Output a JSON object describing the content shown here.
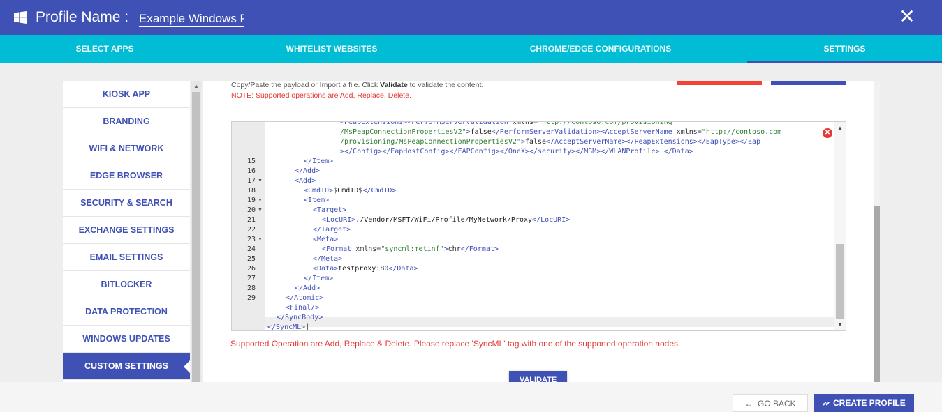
{
  "header": {
    "title_label": "Profile Name :",
    "profile_name_value": "Example Windows Pr",
    "close_label": "✕"
  },
  "tabs": [
    {
      "label": "SELECT APPS"
    },
    {
      "label": "WHITELIST WEBSITES"
    },
    {
      "label": "CHROME/EDGE CONFIGURATIONS"
    },
    {
      "label": "SETTINGS"
    }
  ],
  "sidebar": {
    "items": [
      {
        "label": "KIOSK APP"
      },
      {
        "label": "BRANDING"
      },
      {
        "label": "WIFI & NETWORK"
      },
      {
        "label": "EDGE BROWSER"
      },
      {
        "label": "SECURITY & SEARCH"
      },
      {
        "label": "EXCHANGE SETTINGS"
      },
      {
        "label": "EMAIL SETTINGS"
      },
      {
        "label": "BITLOCKER"
      },
      {
        "label": "DATA PROTECTION"
      },
      {
        "label": "WINDOWS UPDATES"
      },
      {
        "label": "CUSTOM SETTINGS"
      }
    ],
    "active_index": 10
  },
  "content": {
    "hint_before": "Copy/Paste the payload or Import a file. Click ",
    "hint_bold": "Validate",
    "hint_after": " to validate the content.",
    "note": "NOTE: Supported operations are Add, Replace, Delete.",
    "error_message": "Supported Operation are Add, Replace & Delete. Please replace 'SyncML' tag with one of the supported operation nodes.",
    "validate_label": "VALIDATE"
  },
  "editor": {
    "error_icon": "✕",
    "lines": [
      {
        "num": "",
        "fold": false,
        "indent": 8,
        "html": "<span class=\"tag\">&lt;PeapExtensions&gt;&lt;PerformServerValidation</span> <span class=\"attr\">xmlns=</span><span class=\"val\">\"http://contoso.com/provisioning</span>"
      },
      {
        "num": "",
        "fold": false,
        "indent": 8,
        "html": "<span class=\"val\">/MsPeapConnectionPropertiesV2\"</span><span class=\"tag\">&gt;</span><span class=\"txt\">false</span><span class=\"tag\">&lt;/PerformServerValidation&gt;&lt;AcceptServerName</span> <span class=\"attr\">xmlns=</span><span class=\"val\">\"http://contoso.com</span>"
      },
      {
        "num": "",
        "fold": false,
        "indent": 8,
        "html": "<span class=\"val\">/provisioning/MsPeapConnectionPropertiesV2\"</span><span class=\"tag\">&gt;</span><span class=\"txt\">false</span><span class=\"tag\">&lt;/AcceptServerName&gt;&lt;/PeapExtensions&gt;&lt;/EapType&gt;&lt;/Eap</span>"
      },
      {
        "num": "",
        "fold": false,
        "indent": 8,
        "html": "<span class=\"tag\">&gt;&lt;/Config&gt;&lt;/EapHostConfig&gt;&lt;/EAPConfig&gt;&lt;/OneX&gt;&lt;/security&gt;&lt;/MSM&gt;&lt;/WLANProfile&gt;</span> <span class=\"tag\">&lt;/Data&gt;</span>"
      },
      {
        "num": "15",
        "fold": false,
        "indent": 4,
        "html": "<span class=\"tag\">&lt;/Item&gt;</span>"
      },
      {
        "num": "16",
        "fold": false,
        "indent": 3,
        "html": "<span class=\"tag\">&lt;/Add&gt;</span>"
      },
      {
        "num": "17",
        "fold": true,
        "indent": 3,
        "html": "<span class=\"tag\">&lt;Add&gt;</span>"
      },
      {
        "num": "18",
        "fold": false,
        "indent": 4,
        "html": "<span class=\"tag\">&lt;CmdID&gt;</span><span class=\"txt\">$CmdID$</span><span class=\"tag\">&lt;/CmdID&gt;</span>"
      },
      {
        "num": "19",
        "fold": true,
        "indent": 4,
        "html": "<span class=\"tag\">&lt;Item&gt;</span>"
      },
      {
        "num": "20",
        "fold": true,
        "indent": 5,
        "html": "<span class=\"tag\">&lt;Target&gt;</span>"
      },
      {
        "num": "21",
        "fold": false,
        "indent": 6,
        "html": "<span class=\"tag\">&lt;LocURI&gt;</span><span class=\"txt\">./Vendor/MSFT/WiFi/Profile/MyNetwork/Proxy</span><span class=\"tag\">&lt;/LocURI&gt;</span>"
      },
      {
        "num": "22",
        "fold": false,
        "indent": 5,
        "html": "<span class=\"tag\">&lt;/Target&gt;</span>"
      },
      {
        "num": "23",
        "fold": true,
        "indent": 5,
        "html": "<span class=\"tag\">&lt;Meta&gt;</span>"
      },
      {
        "num": "24",
        "fold": false,
        "indent": 6,
        "html": "<span class=\"tag\">&lt;Format</span> <span class=\"attr\">xmlns=</span><span class=\"val\">\"syncml:metinf\"</span><span class=\"tag\">&gt;</span><span class=\"txt\">chr</span><span class=\"tag\">&lt;/Format&gt;</span>"
      },
      {
        "num": "25",
        "fold": false,
        "indent": 5,
        "html": "<span class=\"tag\">&lt;/Meta&gt;</span>"
      },
      {
        "num": "26",
        "fold": false,
        "indent": 5,
        "html": "<span class=\"tag\">&lt;Data&gt;</span><span class=\"txt\">testproxy:80</span><span class=\"tag\">&lt;/Data&gt;</span>"
      },
      {
        "num": "27",
        "fold": false,
        "indent": 4,
        "html": "<span class=\"tag\">&lt;/Item&gt;</span>"
      },
      {
        "num": "28",
        "fold": false,
        "indent": 3,
        "html": "<span class=\"tag\">&lt;/Add&gt;</span>"
      },
      {
        "num": "29",
        "fold": false,
        "indent": 2,
        "html": "<span class=\"tag\">&lt;/Atomic&gt;</span>"
      },
      {
        "num": "",
        "fold": false,
        "indent": 2,
        "html": "<span class=\"tag\">&lt;Final/&gt;</span>"
      },
      {
        "num": "",
        "fold": false,
        "indent": 1,
        "html": "<span class=\"tag\">&lt;/SyncBody&gt;</span>"
      },
      {
        "num": "",
        "fold": false,
        "indent": 0,
        "html": "<span class=\"tag\">&lt;/SyncML&gt;</span><span class=\"txt\">|</span>"
      }
    ]
  },
  "footer": {
    "goback_label": "GO BACK",
    "goback_icon": "←",
    "create_label": "CREATE PROFILE",
    "create_icon": "✔✔"
  },
  "colors": {
    "primary": "#3f51b5",
    "tabbar": "#00bcd4",
    "error": "#e53935"
  }
}
